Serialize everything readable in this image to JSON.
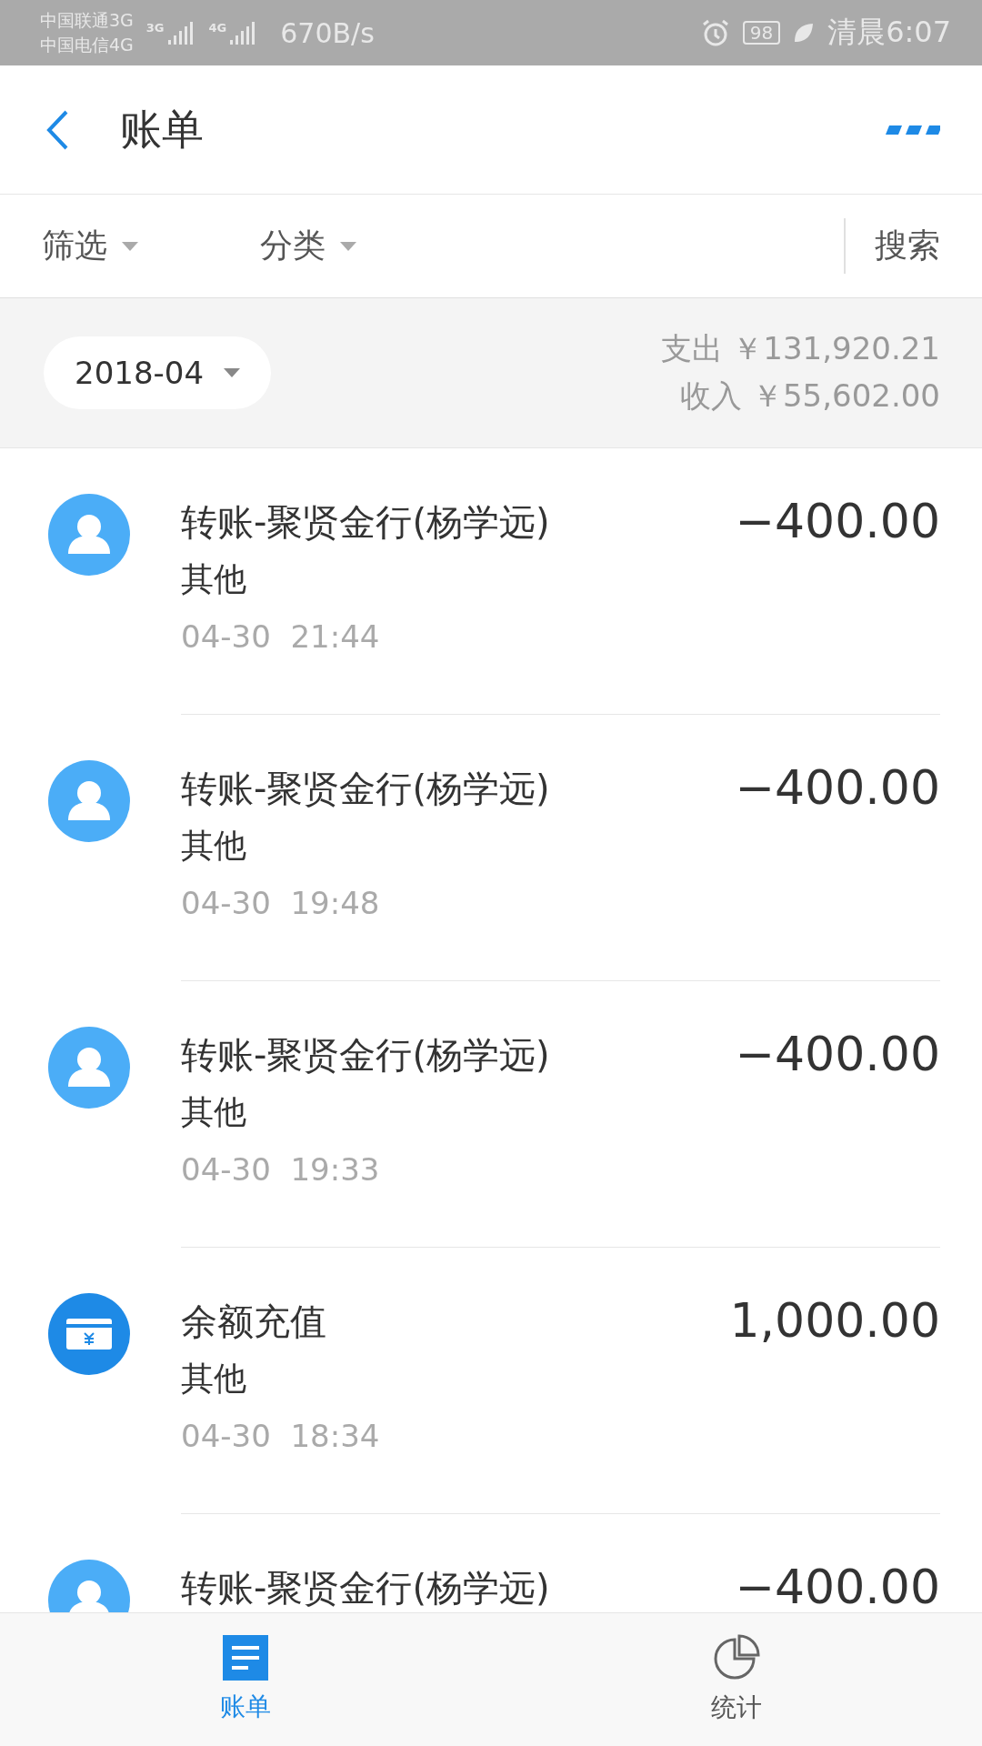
{
  "status_bar": {
    "carriers": [
      "中国联通3G",
      "中国电信4G"
    ],
    "signal_labels": [
      "3G",
      "4G"
    ],
    "speed": "670B/s",
    "battery": "98",
    "time": "清晨6:07"
  },
  "header": {
    "title": "账单"
  },
  "filters": [
    {
      "label": "筛选"
    },
    {
      "label": "分类"
    }
  ],
  "search": "搜索",
  "summary": {
    "month": "2018-04",
    "rows": [
      {
        "label": "支出",
        "amount": "￥131,920.21"
      },
      {
        "label": "收入",
        "amount": "￥55,602.00"
      }
    ]
  },
  "transactions": [
    {
      "kind": "person",
      "title": "转账-聚贤金行(杨学远)",
      "category": "其他",
      "date": "04-30",
      "time": "21:44",
      "amount": "−400.00"
    },
    {
      "kind": "person",
      "title": "转账-聚贤金行(杨学远)",
      "category": "其他",
      "date": "04-30",
      "time": "19:48",
      "amount": "−400.00"
    },
    {
      "kind": "person",
      "title": "转账-聚贤金行(杨学远)",
      "category": "其他",
      "date": "04-30",
      "time": "19:33",
      "amount": "−400.00"
    },
    {
      "kind": "card",
      "title": "余额充值",
      "category": "其他",
      "date": "04-30",
      "time": "18:34",
      "amount": "1,000.00"
    },
    {
      "kind": "person",
      "title": "转账-聚贤金行(杨学远)",
      "amount": "−400.00"
    }
  ],
  "bottom_nav": [
    {
      "kind": "list",
      "label": "账单",
      "selected": true
    },
    {
      "kind": "chart",
      "label": "统计",
      "selected": false
    }
  ]
}
